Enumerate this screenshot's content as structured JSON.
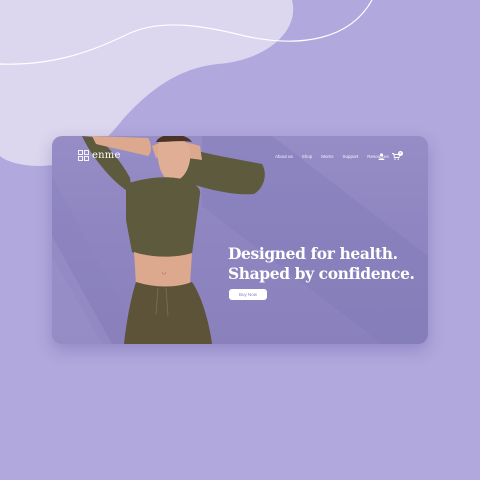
{
  "brand": {
    "name": "enme"
  },
  "nav": {
    "links": [
      "About us",
      "Shop",
      "Moms",
      "Support",
      "Resources"
    ],
    "user_icon": "user-icon",
    "cart_icon": "cart-icon",
    "cart_count": "0"
  },
  "hero": {
    "headline_line1": "Designed for health.",
    "headline_line2": "Shaped by confidence.",
    "cta_label": "Buy Now"
  },
  "colors": {
    "page_background": "#b1a8dd",
    "blob_light": "#dcd6ee",
    "hero_background": "#968dc6",
    "top_color": "#5d5a3d",
    "pants_color": "#5c5339",
    "skin_color": "#dca88e",
    "text": "#ffffff"
  }
}
